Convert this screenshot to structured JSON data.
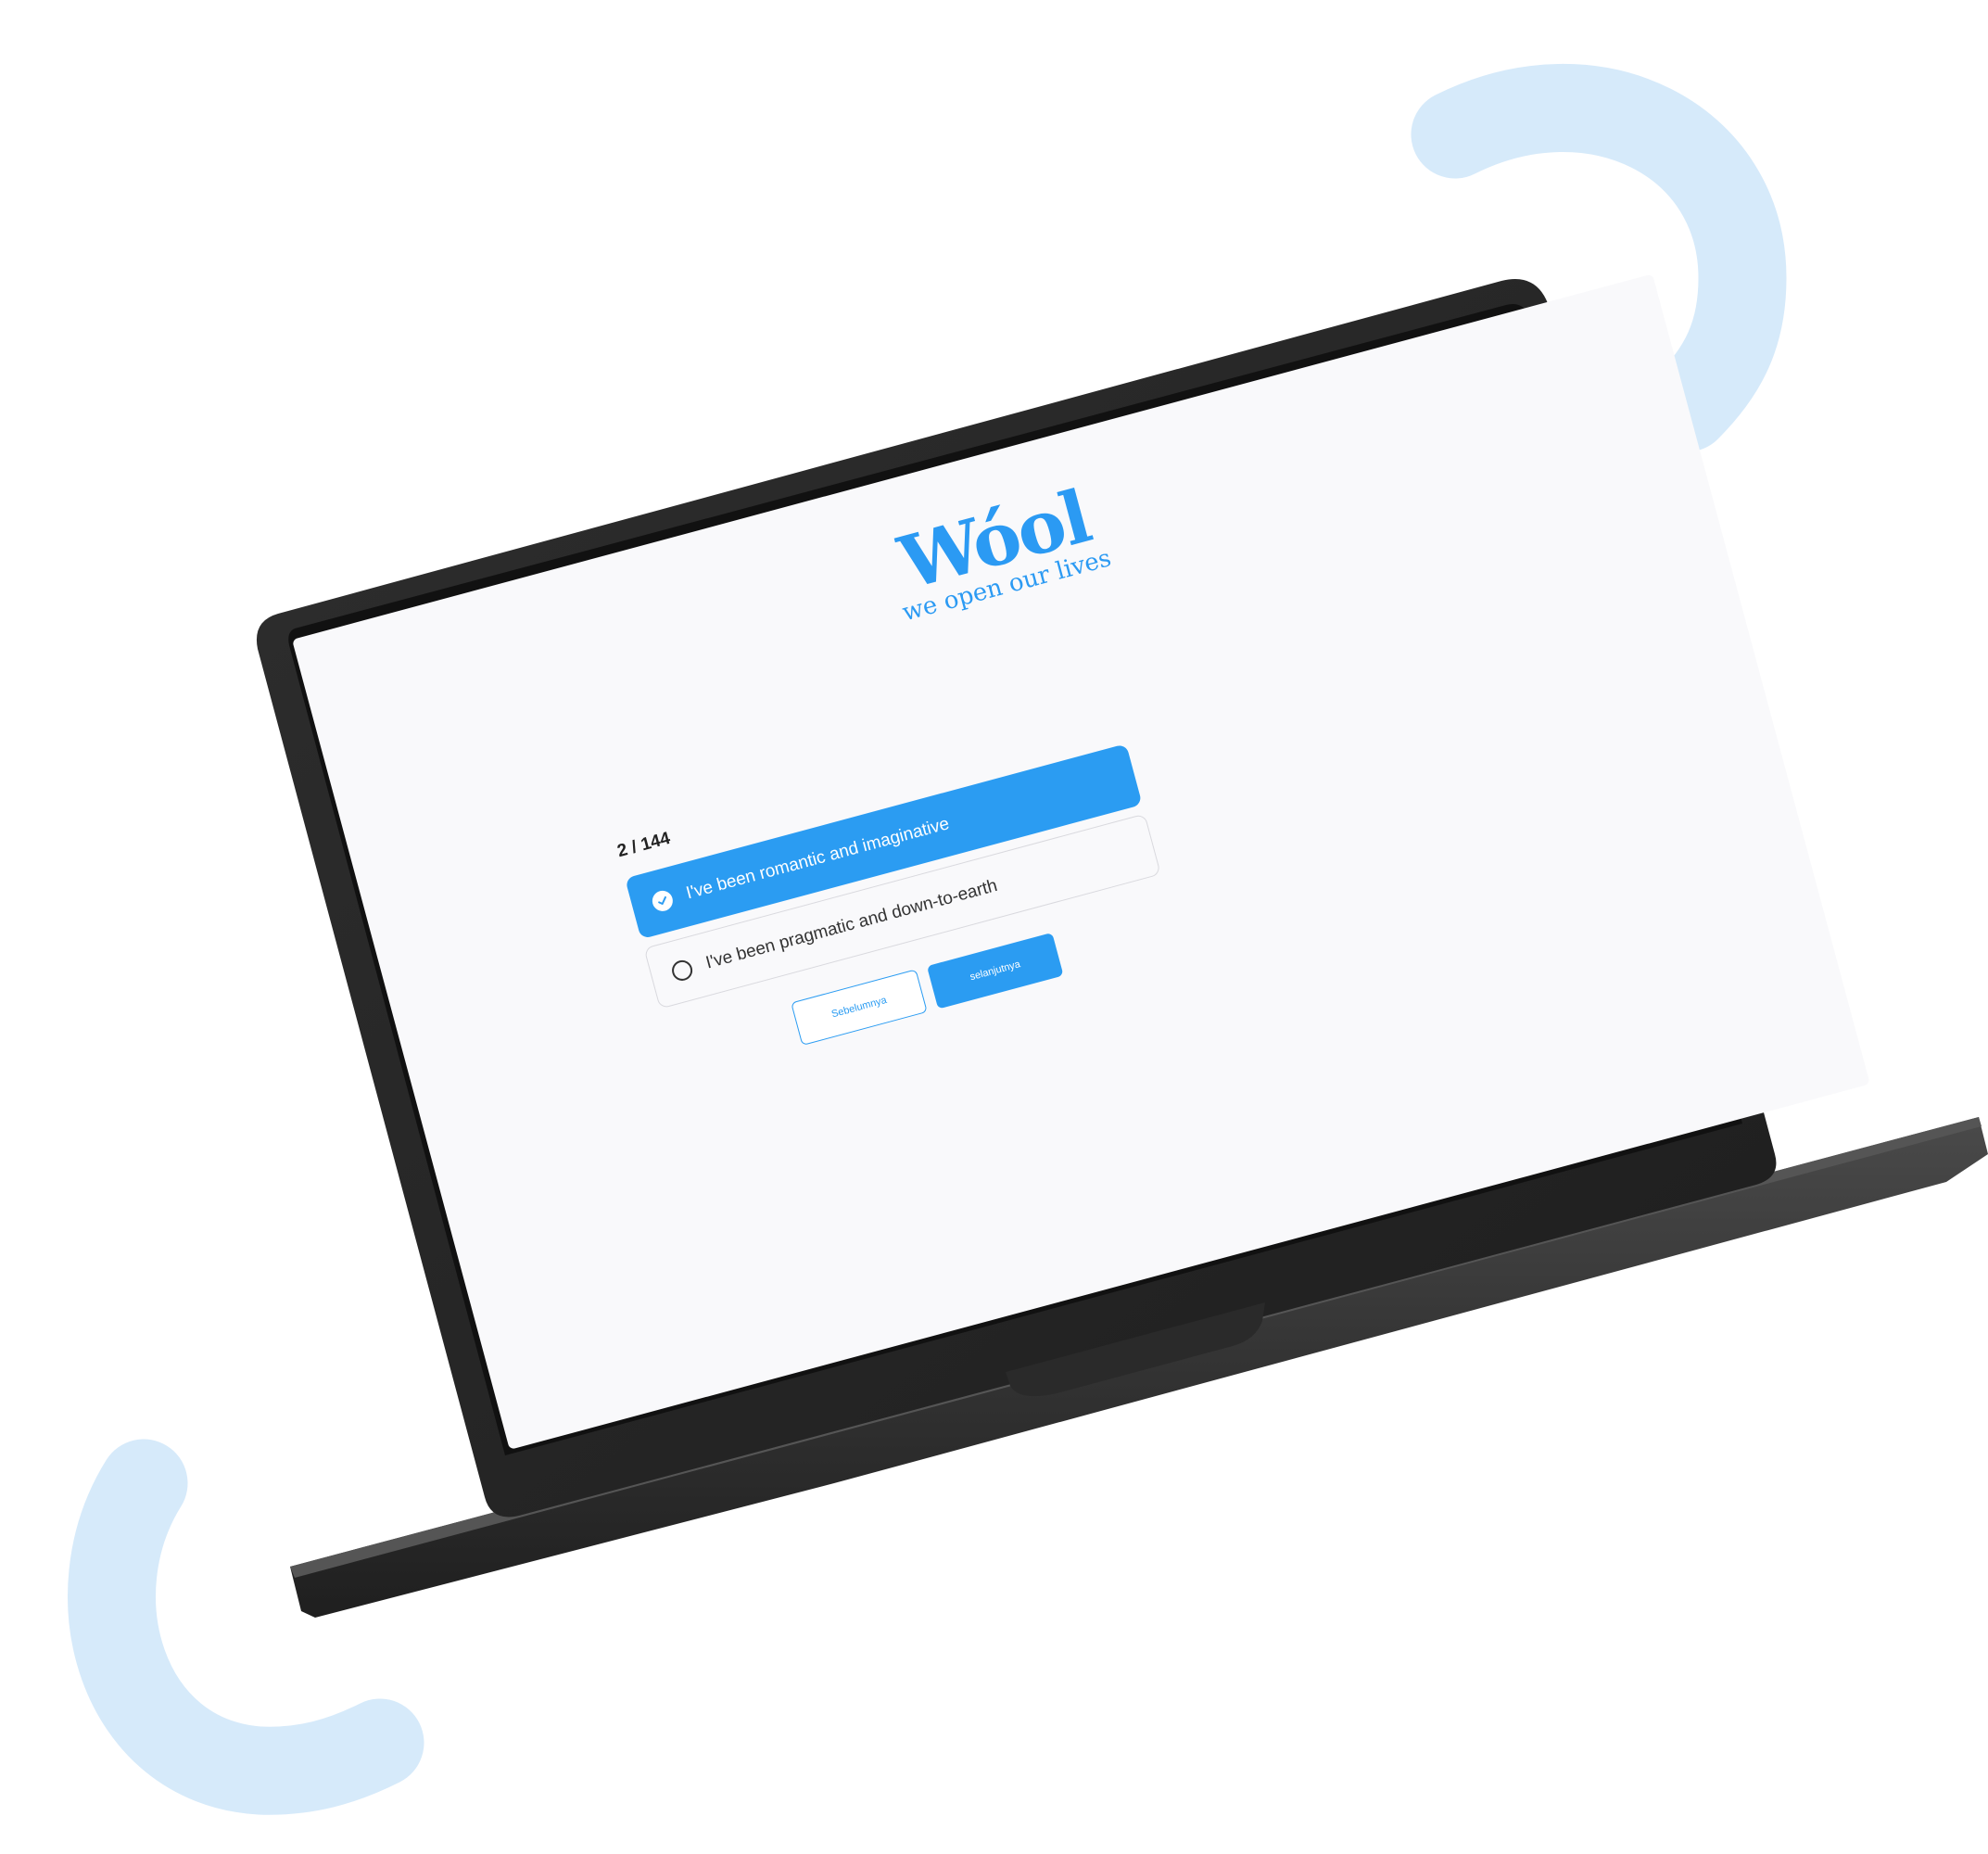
{
  "colors": {
    "accent": "#2b9cf2",
    "decoration": "#d6eafa",
    "screen_background": "#f9f9fb",
    "laptop_body": "#2a2a2a"
  },
  "app": {
    "logo_text": "Wóol",
    "tagline": "we open our lives"
  },
  "quiz": {
    "progress": "2 / 144",
    "options": [
      {
        "label": "I've been romantic and imaginative",
        "selected": true
      },
      {
        "label": "I've been pragmatic and down-to-earth",
        "selected": false
      }
    ]
  },
  "buttons": {
    "previous": "Sebelumnya",
    "next": "selanjutnya"
  },
  "icons": {
    "selected_indicator": "check-circle-icon",
    "unselected_indicator": "radio-empty-icon"
  }
}
